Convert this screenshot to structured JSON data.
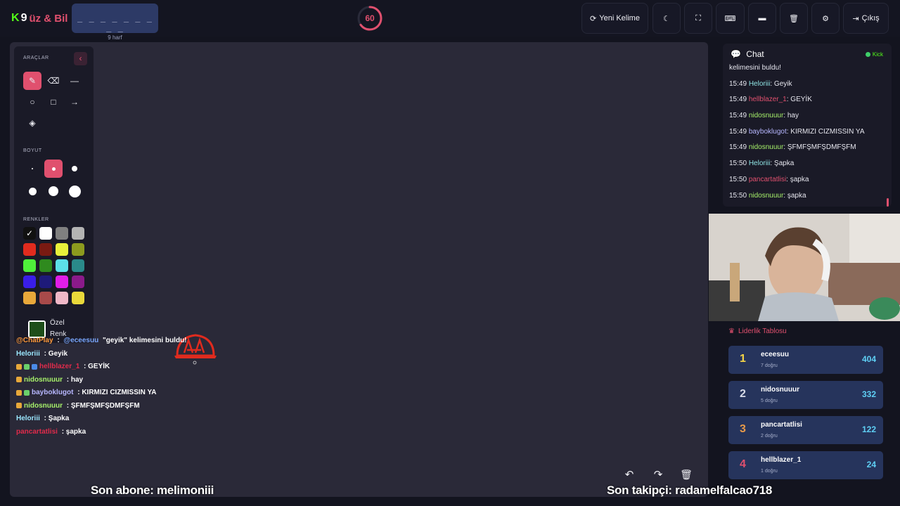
{
  "app": {
    "logo_letter": "K",
    "logo_number": "9",
    "logo_name": "üz & Bil"
  },
  "word": {
    "blanks": "_ _ _ _ _ _ _ _ _",
    "length_label": "9 harf"
  },
  "timer": {
    "value": "60",
    "fraction_remaining": 0.65
  },
  "toolbar": {
    "new_word_label": "Yeni Kelime",
    "exit_label": "Çıkış"
  },
  "tools_panel": {
    "tools_title": "ARAÇLAR",
    "size_title": "BOYUT",
    "colors_title": "RENKLER",
    "custom_color_label_1": "Özel",
    "custom_color_label_2": "Renk",
    "custom_color": "#1e4e1a",
    "colors": [
      "#111111",
      "#ffffff",
      "#808080",
      "#b3b3b3",
      "#e02b1e",
      "#7a1a12",
      "#e8f03a",
      "#8c9a1e",
      "#4ff03a",
      "#2f8a1e",
      "#5ce0e8",
      "#2a8a8a",
      "#3a1ee8",
      "#1e1a7a",
      "#e01ee8",
      "#8a1a8a",
      "#e8a83a",
      "#a84a4a",
      "#f0b8c8",
      "#e8d83a"
    ]
  },
  "canvas_chat": [
    {
      "user": "@ChatPlay",
      "user_color": "#ff9a3c",
      "text": " : ",
      "mention": "@eceesuu",
      "rest": " \"geyik\" kelimesini buldu!"
    },
    {
      "user": "Heloriii",
      "user_color": "#9be7ff",
      "text": " : Geyik"
    },
    {
      "user": "hellblazer_1",
      "user_color": "#e02b4b",
      "text": " : GEYİK",
      "badges": 3
    },
    {
      "user": "nidosnuuur",
      "user_color": "#a6f06a",
      "text": " : hay",
      "badges": 1
    },
    {
      "user": "bayboklugot",
      "user_color": "#b7b7ff",
      "text": " : KIRMIZI CIZMISSIN YA",
      "badges": 2
    },
    {
      "user": "nidosnuuur",
      "user_color": "#a6f06a",
      "text": " : ŞFMFŞMFŞDMFŞFM",
      "badges": 1
    },
    {
      "user": "Heloriii",
      "user_color": "#9be7ff",
      "text": " : Şapka"
    },
    {
      "user": "pancartatlisi",
      "user_color": "#e02b4b",
      "text": " : şapka"
    }
  ],
  "chat_panel": {
    "title": "Chat",
    "platform": "Kick",
    "messages": [
      {
        "time": "",
        "user": "",
        "user_color": "#e6e6ee",
        "text": "kelimesini buldu!"
      },
      {
        "time": "15:49",
        "user": "Heloriii",
        "user_color": "#8fe3e3",
        "text": ": Geyik"
      },
      {
        "time": "15:49",
        "user": "hellblazer_1",
        "user_color": "#e0506e",
        "text": ": GEYİK"
      },
      {
        "time": "15:49",
        "user": "nidosnuuur",
        "user_color": "#a6f06a",
        "text": ": hay"
      },
      {
        "time": "15:49",
        "user": "bayboklugot",
        "user_color": "#b7b7ff",
        "text": ": KIRMIZI CIZMISSIN YA"
      },
      {
        "time": "15:49",
        "user": "nidosnuuur",
        "user_color": "#a6f06a",
        "text": ": ŞFMFŞMFŞDMFŞFM"
      },
      {
        "time": "15:50",
        "user": "Heloriii",
        "user_color": "#8fe3e3",
        "text": ": Şapka"
      },
      {
        "time": "15:50",
        "user": "pancartatlisi",
        "user_color": "#e0506e",
        "text": ": şapka"
      },
      {
        "time": "15:50",
        "user": "nidosnuuur",
        "user_color": "#a6f06a",
        "text": ": şapka"
      }
    ]
  },
  "leaderboard": {
    "title": "Liderlik Tablosu",
    "rows": [
      {
        "rank": "1",
        "rank_color": "#f5d547",
        "name": "eceesuu",
        "correct": "7 doğru",
        "score": "404"
      },
      {
        "rank": "2",
        "rank_color": "#d8dce8",
        "name": "nidosnuuur",
        "correct": "5 doğru",
        "score": "332"
      },
      {
        "rank": "3",
        "rank_color": "#e89a4a",
        "name": "pancartatlisi",
        "correct": "2 doğru",
        "score": "122"
      },
      {
        "rank": "4",
        "rank_color": "#e0506e",
        "name": "hellblazer_1",
        "correct": "1 doğru",
        "score": "24"
      }
    ]
  },
  "footer": {
    "last_sub": "Son abone: melimoniii",
    "last_follower": "Son takipçi: radamelfalcao718"
  }
}
